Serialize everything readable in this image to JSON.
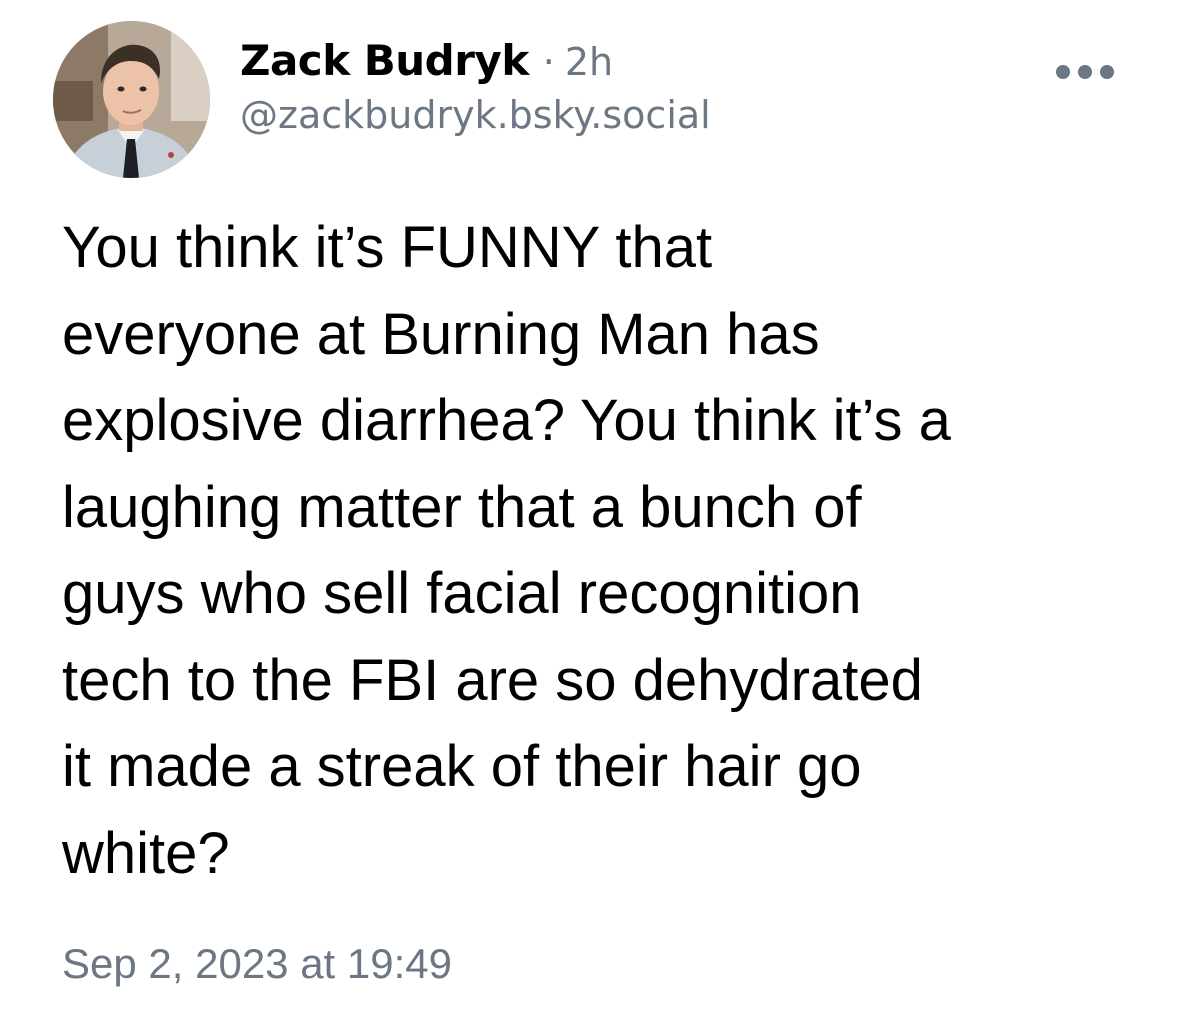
{
  "post": {
    "author": {
      "display_name": "Zack Budryk",
      "handle": "@zackbudryk.bsky.social",
      "relative_time": "2h",
      "separator": "·"
    },
    "menu_icon": "more-horizontal-icon",
    "text_lines": [
      "You think it’s FUNNY that",
      "everyone at Burning Man has",
      "explosive diarrhea? You think it’s a",
      "laughing matter that a bunch of",
      "guys who sell facial recognition",
      "tech to the FBI are so dehydrated",
      "it made a streak of their hair go",
      "white?"
    ],
    "timestamp": "Sep 2, 2023 at 19:49"
  },
  "colors": {
    "text_primary": "#000000",
    "text_secondary": "#6b7785",
    "background": "#ffffff"
  }
}
